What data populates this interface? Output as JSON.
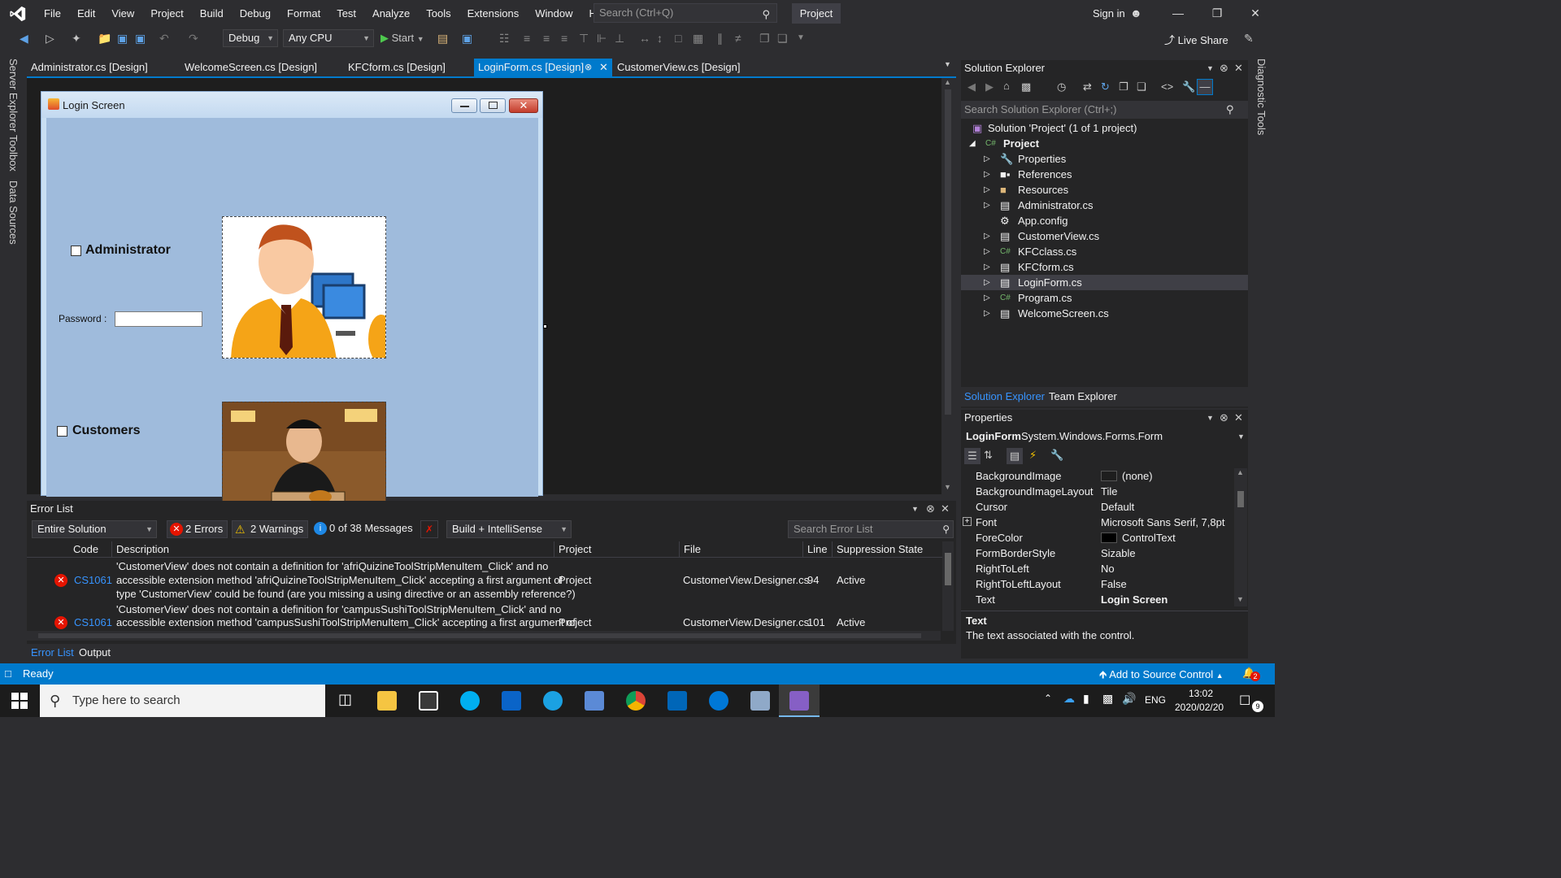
{
  "titlebar": {
    "menu": [
      "File",
      "Edit",
      "View",
      "Project",
      "Build",
      "Debug",
      "Format",
      "Test",
      "Analyze",
      "Tools",
      "Extensions",
      "Window",
      "Help"
    ],
    "search_placeholder": "Search (Ctrl+Q)",
    "project_label": "Project",
    "sign_in": "Sign in"
  },
  "toolbar": {
    "config": "Debug",
    "platform": "Any CPU",
    "start": "Start",
    "live_share": "Live Share"
  },
  "left_strip": [
    "Server Explorer",
    "Toolbox",
    "Data Sources"
  ],
  "right_strip": [
    "Diagnostic Tools"
  ],
  "doc_tabs": [
    {
      "label": "Administrator.cs [Design]"
    },
    {
      "label": "WelcomeScreen.cs [Design]"
    },
    {
      "label": "KFCform.cs [Design]"
    },
    {
      "label": "LoginForm.cs [Design]"
    },
    {
      "label": "CustomerView.cs [Design]"
    }
  ],
  "form": {
    "title": "Login Screen",
    "admin_label": "Administrator",
    "password_label": "Password :",
    "customers_label": "Customers"
  },
  "error_list": {
    "title": "Error List",
    "scope": "Entire Solution",
    "errors_btn": "2 Errors",
    "warnings_btn": "2 Warnings",
    "messages_btn": "0 of 38 Messages",
    "build_filter": "Build + IntelliSense",
    "search_placeholder": "Search Error List",
    "columns": [
      "Code",
      "Description",
      "Project",
      "File",
      "Line",
      "Suppression State"
    ],
    "rows": [
      {
        "code": "CS1061",
        "desc1": "'CustomerView' does not contain a definition for 'afriQuizineToolStripMenuItem_Click' and no",
        "desc2": "accessible extension method 'afriQuizineToolStripMenuItem_Click' accepting a first argument of",
        "desc3": "type 'CustomerView' could be found (are you missing a using directive or an assembly reference?)",
        "project": "Project",
        "file": "CustomerView.Designer.cs",
        "line": "94",
        "state": "Active"
      },
      {
        "code": "CS1061",
        "desc1": "'CustomerView' does not contain a definition for 'campusSushiToolStripMenuItem_Click' and no",
        "desc2": "accessible extension method 'campusSushiToolStripMenuItem_Click' accepting a first argument of",
        "project": "Project",
        "file": "CustomerView.Designer.cs",
        "line": "101",
        "state": "Active"
      }
    ],
    "bottom_tabs": [
      "Error List",
      "Output"
    ]
  },
  "solution_explorer": {
    "title": "Solution Explorer",
    "search_placeholder": "Search Solution Explorer (Ctrl+;)",
    "solution": "Solution 'Project' (1 of 1 project)",
    "project": "Project",
    "items": [
      "Properties",
      "References",
      "Resources",
      "Administrator.cs",
      "App.config",
      "CustomerView.cs",
      "KFCclass.cs",
      "KFCform.cs",
      "LoginForm.cs",
      "Program.cs",
      "WelcomeScreen.cs"
    ],
    "bottom_tabs": [
      "Solution Explorer",
      "Team Explorer"
    ]
  },
  "properties": {
    "title": "Properties",
    "object_name": "LoginForm",
    "object_type": "System.Windows.Forms.Form",
    "rows": [
      {
        "name": "BackgroundImage",
        "value": "(none)"
      },
      {
        "name": "BackgroundImageLayout",
        "value": "Tile"
      },
      {
        "name": "Cursor",
        "value": "Default"
      },
      {
        "name": "Font",
        "value": "Microsoft Sans Serif, 7,8pt"
      },
      {
        "name": "ForeColor",
        "value": "ControlText"
      },
      {
        "name": "FormBorderStyle",
        "value": "Sizable"
      },
      {
        "name": "RightToLeft",
        "value": "No"
      },
      {
        "name": "RightToLeftLayout",
        "value": "False"
      },
      {
        "name": "Text",
        "value": "Login Screen"
      }
    ],
    "desc_title": "Text",
    "desc_text": "The text associated with the control."
  },
  "statusbar": {
    "ready": "Ready",
    "source_control": "Add to Source Control",
    "notifications": "2"
  },
  "taskbar": {
    "search_placeholder": "Type here to search",
    "language": "ENG",
    "time": "13:02",
    "date": "2020/02/20",
    "notification_count": "9"
  },
  "colors": {
    "accent": "#007acc",
    "error": "#e51400",
    "warning": "#f0c000"
  }
}
